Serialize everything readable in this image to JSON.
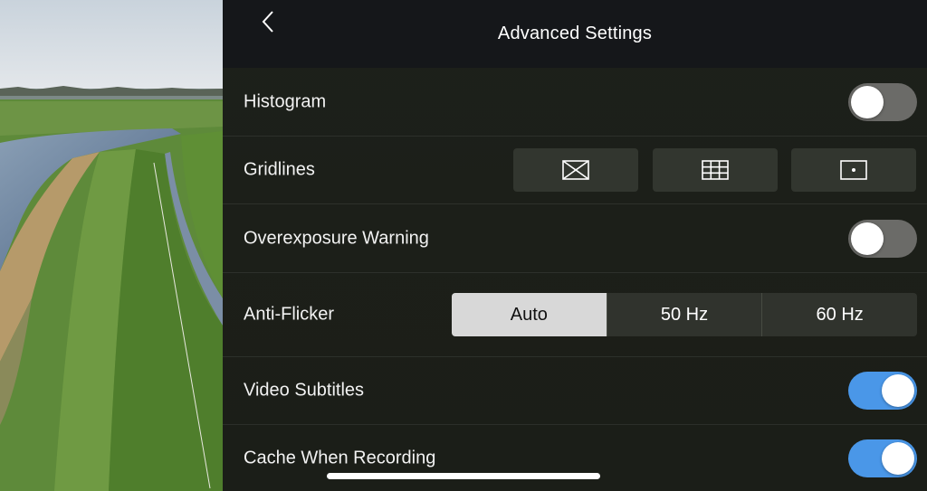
{
  "header": {
    "title": "Advanced Settings",
    "back_icon": "chevron-left-icon"
  },
  "settings": {
    "histogram": {
      "label": "Histogram",
      "enabled": false
    },
    "gridlines": {
      "label": "Gridlines",
      "options": [
        {
          "icon": "diagonal-grid-icon"
        },
        {
          "icon": "grid-3x3-icon"
        },
        {
          "icon": "center-point-icon"
        }
      ]
    },
    "overexposure": {
      "label": "Overexposure Warning",
      "enabled": false
    },
    "anti_flicker": {
      "label": "Anti-Flicker",
      "options": [
        "Auto",
        "50 Hz",
        "60 Hz"
      ],
      "selected": "Auto"
    },
    "video_subtitles": {
      "label": "Video Subtitles",
      "enabled": true
    },
    "cache_recording": {
      "label": "Cache When Recording",
      "enabled": true
    }
  },
  "colors": {
    "toggle_on": "#4a97e8",
    "toggle_off": "#6b6b68",
    "segment_active": "#d8d8d8"
  }
}
